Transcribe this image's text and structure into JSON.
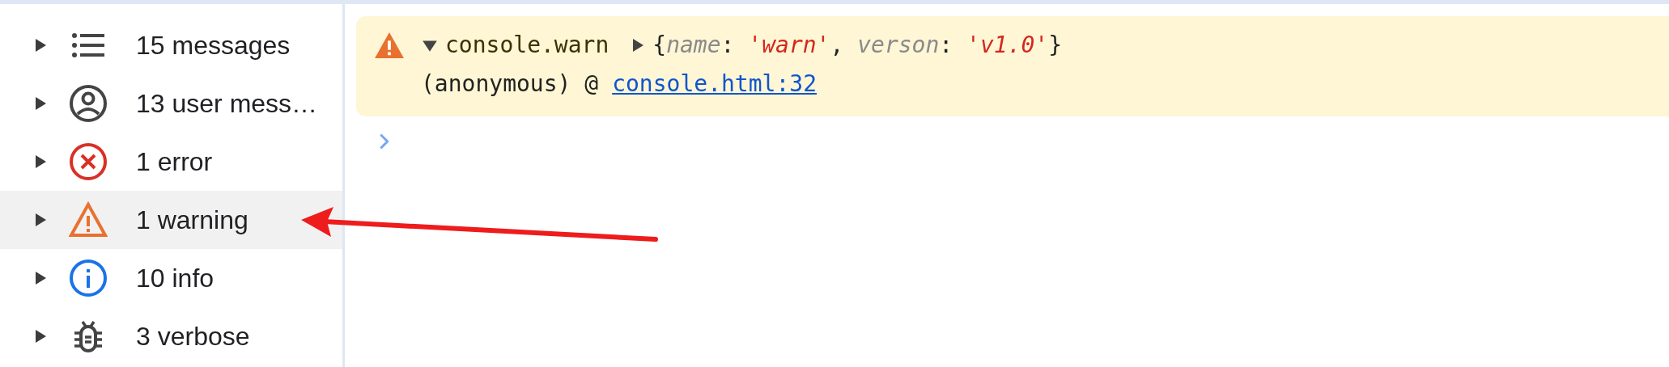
{
  "sidebar": {
    "items": [
      {
        "kind": "all",
        "label": "15 messages",
        "selected": false,
        "expanded": false
      },
      {
        "kind": "user",
        "label": "13 user mess…",
        "selected": false,
        "expanded": false
      },
      {
        "kind": "error",
        "label": "1 error",
        "selected": false,
        "expanded": false
      },
      {
        "kind": "warning",
        "label": "1 warning",
        "selected": true,
        "expanded": false
      },
      {
        "kind": "info",
        "label": "10 info",
        "selected": false,
        "expanded": false
      },
      {
        "kind": "verbose",
        "label": "3 verbose",
        "selected": false,
        "expanded": false
      }
    ]
  },
  "console": {
    "messages": [
      {
        "kind": "warning",
        "expanded": true,
        "source": "console.warn",
        "object_expanded": false,
        "preview": [
          {
            "kind": "punct",
            "text": "{"
          },
          {
            "kind": "key",
            "text": "name"
          },
          {
            "kind": "punct",
            "text": ": "
          },
          {
            "kind": "string",
            "text": "'warn'"
          },
          {
            "kind": "punct",
            "text": ", "
          },
          {
            "kind": "key",
            "text": "verson"
          },
          {
            "kind": "punct",
            "text": ": "
          },
          {
            "kind": "string",
            "text": "'v1.0'"
          },
          {
            "kind": "punct",
            "text": "}"
          }
        ],
        "caller": "(anonymous) @",
        "link": "console.html:32"
      }
    ]
  },
  "annotation": {
    "kind": "arrow"
  }
}
